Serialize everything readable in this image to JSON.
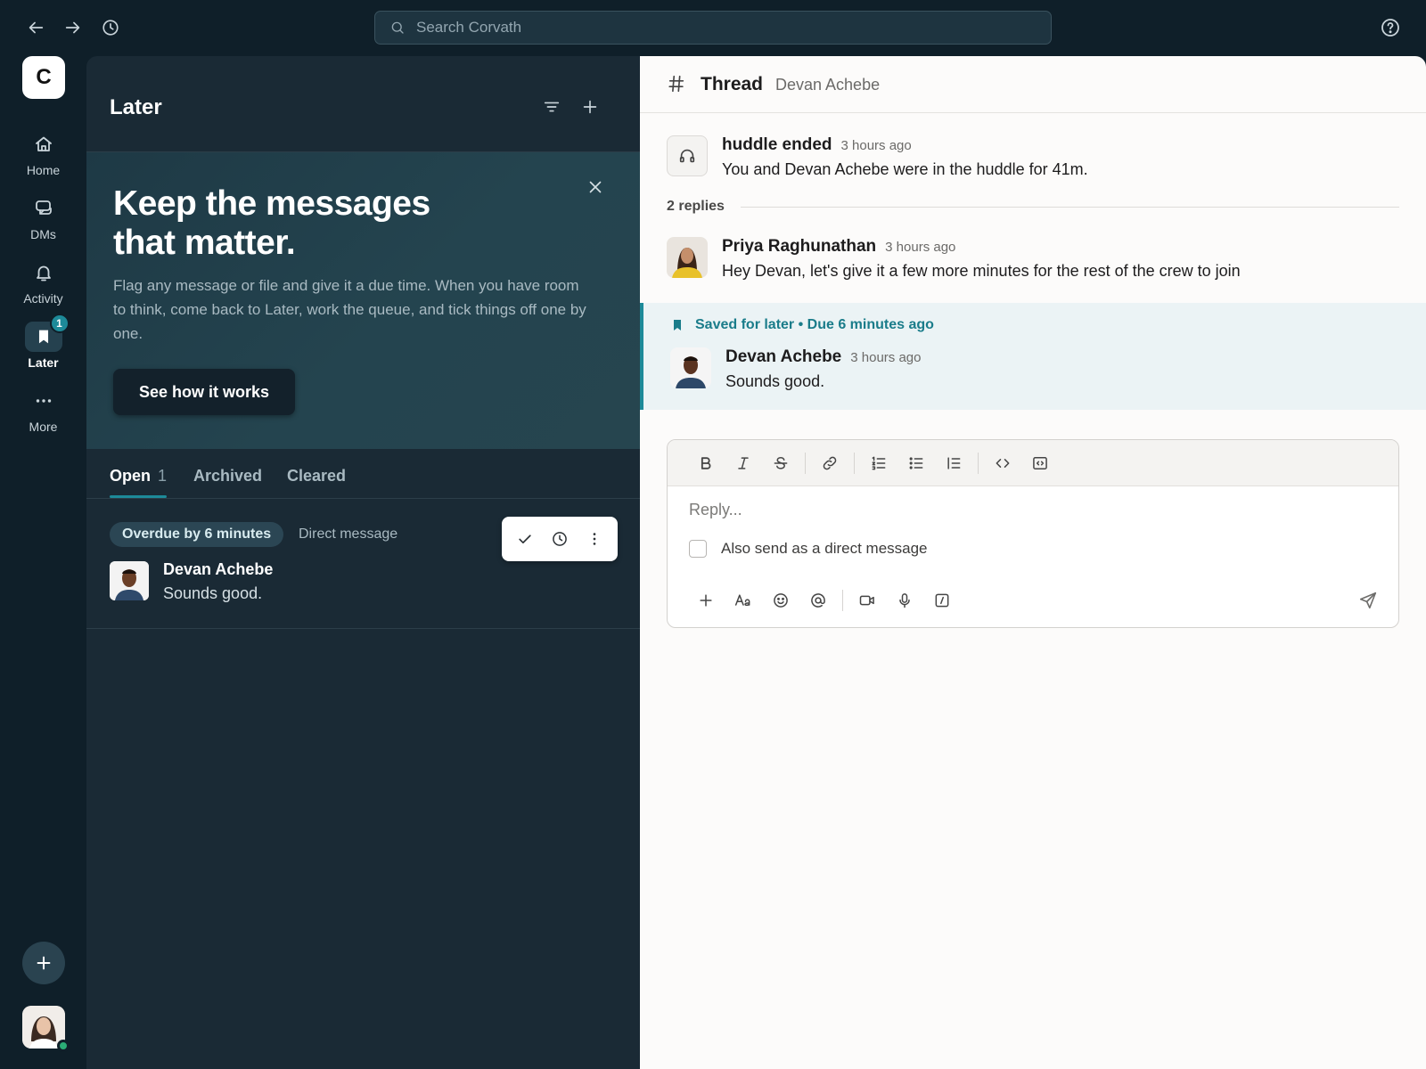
{
  "search": {
    "placeholder": "Search Corvath"
  },
  "workspace": {
    "initial": "C"
  },
  "rail": {
    "items": [
      {
        "label": "Home",
        "icon": "home-icon"
      },
      {
        "label": "DMs",
        "icon": "dms-icon"
      },
      {
        "label": "Activity",
        "icon": "bell-icon"
      },
      {
        "label": "Later",
        "icon": "bookmark-icon",
        "badge": "1"
      },
      {
        "label": "More",
        "icon": "more-icon"
      }
    ]
  },
  "later": {
    "title": "Later",
    "promo": {
      "heading": "Keep the messages that matter.",
      "body": "Flag any message or file and give it a due time. When you have room to think, come back to Later, work the queue, and tick things off one by one.",
      "button": "See how it works"
    },
    "tabs": [
      {
        "label": "Open",
        "count": "1"
      },
      {
        "label": "Archived"
      },
      {
        "label": "Cleared"
      }
    ],
    "item": {
      "status": "Overdue by 6 minutes",
      "kind": "Direct message",
      "name": "Devan Achebe",
      "text": "Sounds good."
    }
  },
  "thread": {
    "title": "Thread",
    "subtitle": "Devan Achebe",
    "huddle": {
      "title": "huddle ended",
      "time": "3 hours ago",
      "text": "You and Devan Achebe were in the huddle for 41m."
    },
    "replies_label": "2 replies",
    "messages": [
      {
        "name": "Priya Raghunathan",
        "time": "3 hours ago",
        "text": "Hey Devan, let's give it a few more minutes for the rest of the crew to join"
      },
      {
        "name": "Devan Achebe",
        "time": "3 hours ago",
        "text": "Sounds good."
      }
    ],
    "saved_label": "Saved for later • Due 6 minutes ago"
  },
  "composer": {
    "placeholder": "Reply...",
    "dm_label": "Also send as a direct message"
  },
  "colors": {
    "accent": "#1d8a99",
    "sidebar": "#0f1f29",
    "panel": "#1a2a35",
    "presence": "#2bac76"
  }
}
